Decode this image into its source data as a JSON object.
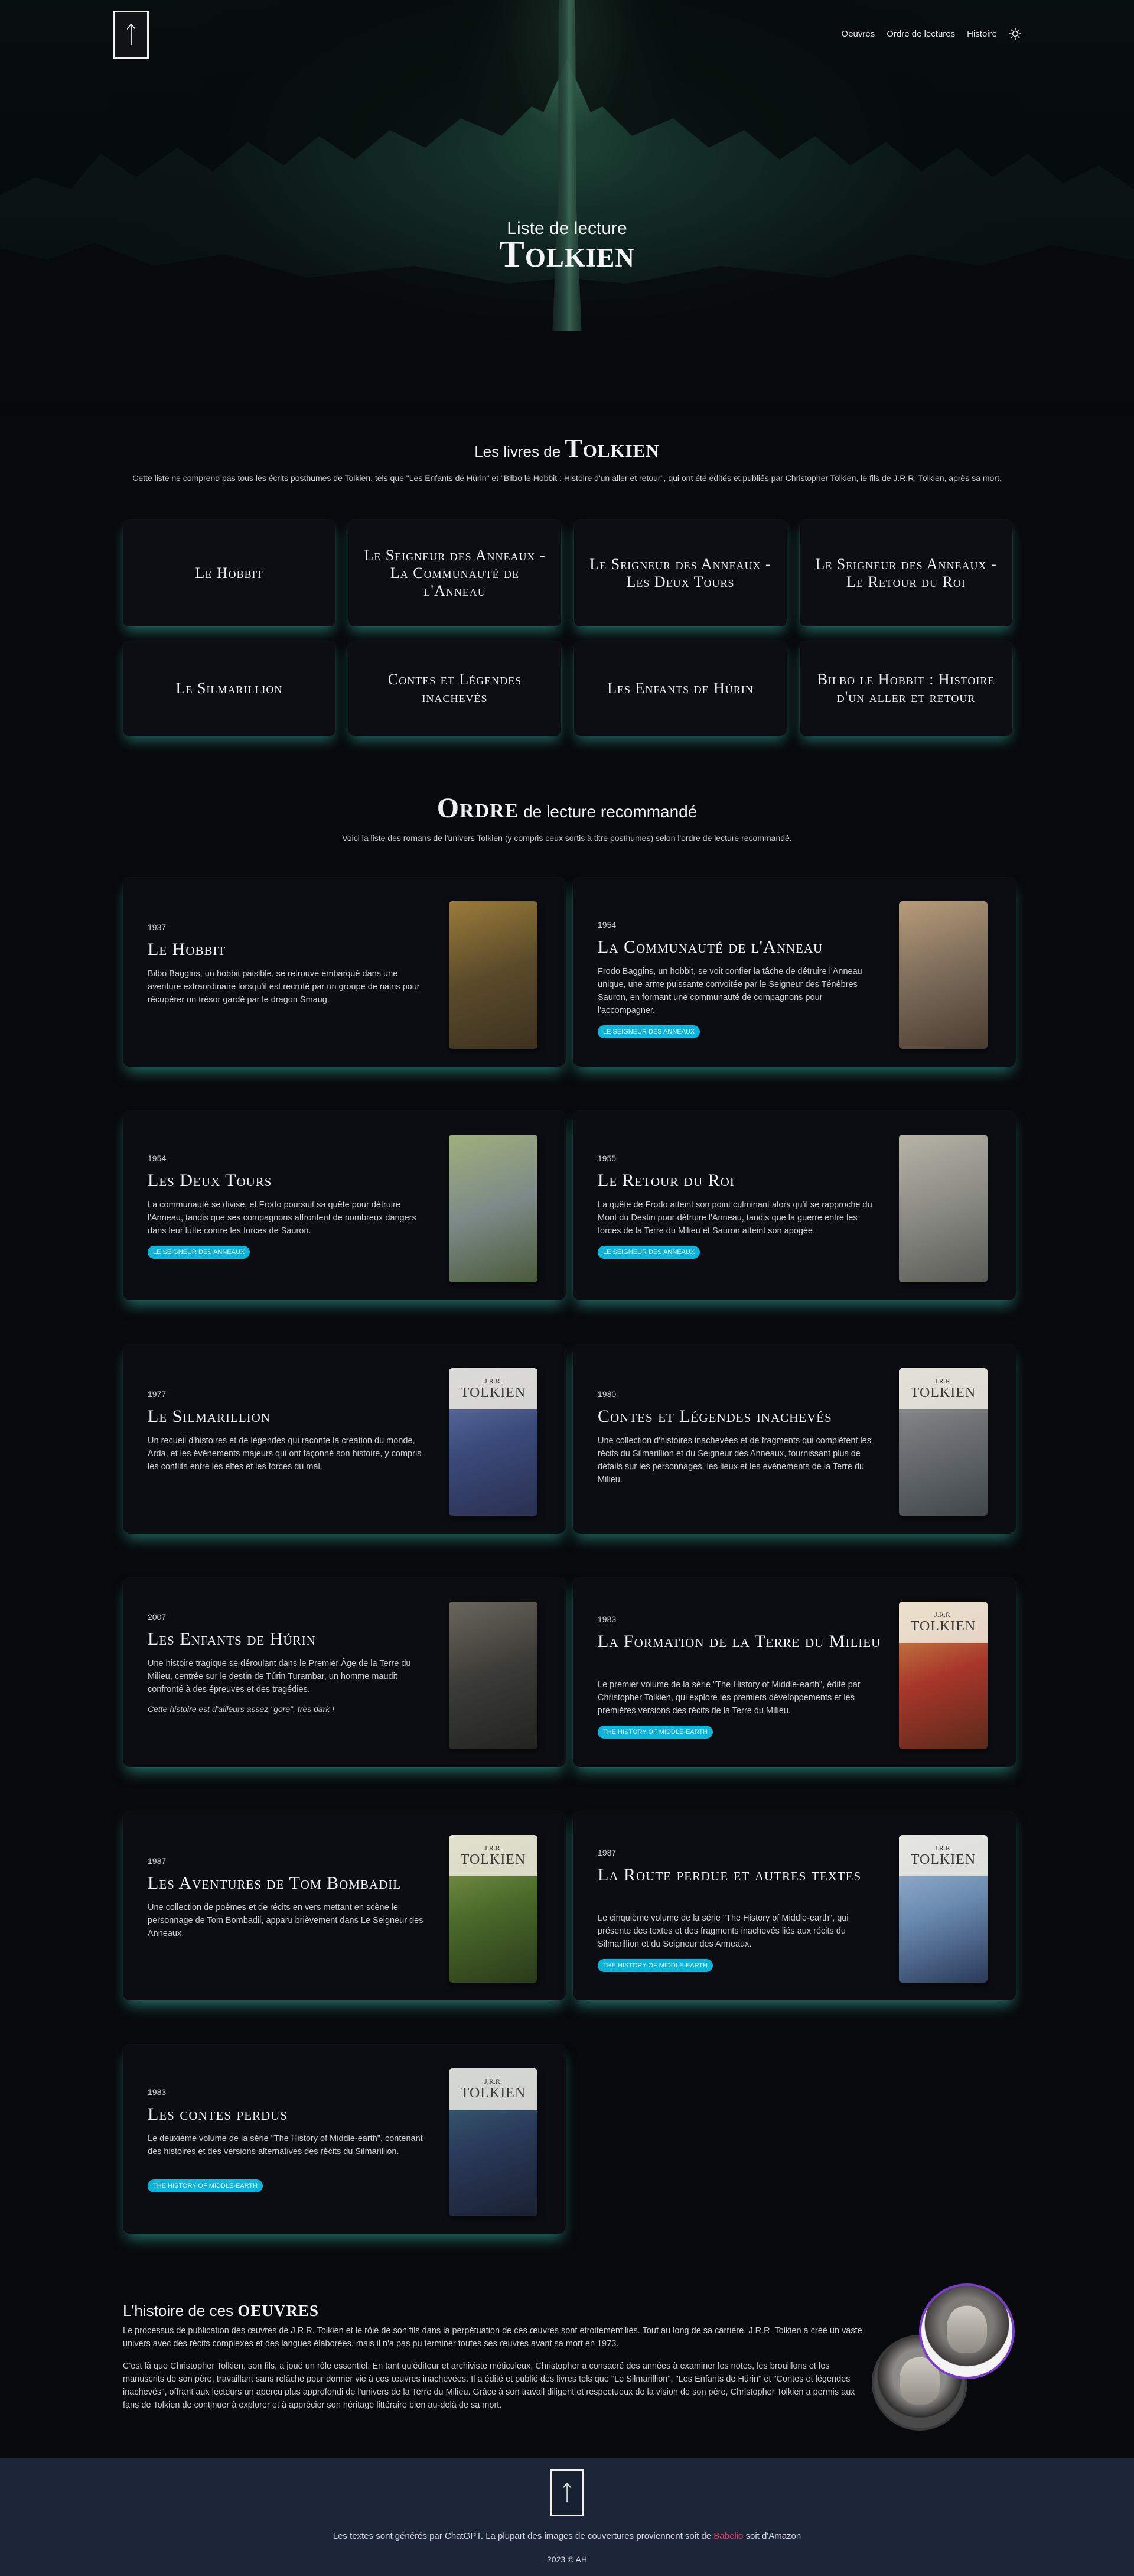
{
  "nav": {
    "items": [
      "Oeuvres",
      "Ordre de lectures",
      "Histoire"
    ],
    "theme_icon": "sun-icon"
  },
  "hero": {
    "subtitle": "Liste de lecture",
    "title": "Tolkien",
    "logo_icon": "tolkien-monogram-icon"
  },
  "books": {
    "title_prefix": "Les livres de",
    "title_big": "Tolkien",
    "description": "Cette liste ne comprend pas tous les écrits posthumes de Tolkien, tels que \"Les Enfants de Húrin\" et \"Bilbo le Hobbit : Histoire d'un aller et retour\", qui ont été édités et publiés par Christopher Tolkien, le fils de J.R.R. Tolkien, après sa mort.",
    "items": [
      "Le Hobbit",
      "Le Seigneur des Anneaux - La Communauté de l'Anneau",
      "Le Seigneur des Anneaux - Les Deux Tours",
      "Le Seigneur des Anneaux - Le Retour du Roi",
      "Le Silmarillion",
      "Contes et Légendes inachevés",
      "Les Enfants de Húrin",
      "Bilbo le Hobbit : Histoire d'un aller et retour"
    ]
  },
  "order": {
    "title_big": "Ordre",
    "title_rest": "de lecture recommandé",
    "description": "Voici la liste des romans de l'univers Tolkien (y compris ceux sortis à titre posthumes) selon l'ordre de lecture recommandé.",
    "cards": [
      {
        "year": "1937",
        "title": "Le Hobbit",
        "desc": "Bilbo Baggins, un hobbit paisible, se retrouve embarqué dans une aventure extraordinaire lorsqu'il est recruté par un groupe de nains pour récupérer un trésor gardé par le dragon Smaug.",
        "badge": "",
        "note": "",
        "cover_top": "",
        "cover_name": "",
        "cover_colors": [
          "#5a4a2a",
          "#9a7b3a",
          "#3d3220"
        ]
      },
      {
        "year": "1954",
        "title": "La Communauté de l'Anneau",
        "desc": "Frodo Baggins, un hobbit, se voit confier la tâche de détruire l'Anneau unique, une arme puissante convoitée par le Seigneur des Ténèbres Sauron, en formant une communauté de compagnons pour l'accompagner.",
        "badge": "Le Seigneur des Anneaux",
        "note": "",
        "cover_top": "",
        "cover_name": "",
        "cover_colors": [
          "#7a6a58",
          "#b89c7a",
          "#4a3c30"
        ]
      },
      {
        "year": "1954",
        "title": "Les Deux Tours",
        "desc": "La communauté se divise, et Frodo poursuit sa quête pour détruire l'Anneau, tandis que ses compagnons affrontent de nombreux dangers dans leur lutte contre les forces de Sauron.",
        "badge": "Le Seigneur des Anneaux",
        "note": "",
        "cover_top": "",
        "cover_name": "",
        "cover_colors": [
          "#7d8a88",
          "#9fb07c",
          "#4a5a3a"
        ]
      },
      {
        "year": "1955",
        "title": "Le Retour du Roi",
        "desc": "La quête de Frodo atteint son point culminant alors qu'il se rapproche du Mont du Destin pour détruire l'Anneau, tandis que la guerre entre les forces de la Terre du Milieu et Sauron atteint son apogée.",
        "badge": "Le Seigneur des Anneaux",
        "note": "",
        "cover_top": "",
        "cover_name": "",
        "cover_colors": [
          "#8a8a84",
          "#b7b3a6",
          "#5a5a56"
        ]
      },
      {
        "year": "1977",
        "title": "Le Silmarillion",
        "desc": "Un recueil d'histoires et de légendes qui raconte la création du monde, Arda, et les événements majeurs qui ont façonné son histoire, y compris les conflits entre les elfes et les forces du mal.",
        "badge": "",
        "note": "",
        "cover_top": "J.R.R.",
        "cover_name": "TOLKIEN",
        "cover_colors": [
          "#3a4a7a",
          "#6a7ab0",
          "#2a3050"
        ]
      },
      {
        "year": "1980",
        "title": "Contes et Légendes inachevés",
        "desc": "Une collection d'histoires inachevées et de fragments qui complètent les récits du Silmarillion et du Seigneur des Anneaux, fournissant plus de détails sur les personnages, les lieux et les événements de la Terre du Milieu.",
        "badge": "",
        "note": "",
        "cover_top": "J.R.R.",
        "cover_name": "TOLKIEN",
        "cover_colors": [
          "#6a6e72",
          "#9a9c98",
          "#40464a"
        ]
      },
      {
        "year": "2007",
        "title": "Les Enfants de Húrin",
        "desc": "Une histoire tragique se déroulant dans le Premier Âge de la Terre du Milieu, centrée sur le destin de Túrin Turambar, un homme maudit confronté à des épreuves et des tragédies.",
        "badge": "",
        "note": "Cette histoire est d'ailleurs assez \"gore\", très dark !",
        "cover_top": "",
        "cover_name": "",
        "cover_colors": [
          "#3a3a36",
          "#6a665c",
          "#22221f"
        ]
      },
      {
        "year": "1983",
        "title": "La Formation de la Terre du Milieu",
        "desc": "Le premier volume de la série \"The History of Middle-earth\", édité par Christopher Tolkien, qui explore les premiers développements et les premières versions des récits de la Terre du Milieu.",
        "badge": "The History of Middle-earth",
        "note": "",
        "cover_top": "J.R.R.",
        "cover_name": "TOLKIEN",
        "cover_colors": [
          "#a8362a",
          "#d0a050",
          "#5a2a1a"
        ]
      },
      {
        "year": "1987",
        "title": "Les Aventures de Tom Bombadil",
        "desc": "Une collection de poèmes et de récits en vers mettant en scène le personnage de Tom Bombadil, apparu brièvement dans Le Seigneur des Anneaux.",
        "badge": "",
        "note": "",
        "cover_top": "J.R.R.",
        "cover_name": "TOLKIEN",
        "cover_colors": [
          "#4a6a2a",
          "#8aa050",
          "#2a3a1a"
        ]
      },
      {
        "year": "1987",
        "title": "La Route perdue et autres textes",
        "desc": "Le cinquième volume de la série \"The History of Middle-earth\", qui présente des textes et des fragments inachevés liés aux récits du Silmarillion et du Seigneur des Anneaux.",
        "badge": "The History of Middle-earth",
        "note": "",
        "cover_top": "J.R.R.",
        "cover_name": "TOLKIEN",
        "cover_colors": [
          "#6a8ab0",
          "#a8c0d8",
          "#2a3a5a"
        ]
      },
      {
        "year": "1983",
        "title": "Les contes perdus",
        "desc": "Le deuxième volume de la série \"The History of Middle-earth\", contenant des histoires et des versions alternatives des récits du Silmarillion.",
        "badge": "The History of Middle-earth",
        "note": "",
        "cover_top": "J.R.R.",
        "cover_name": "TOLKIEN",
        "cover_colors": [
          "#2a3a5a",
          "#3a6a7a",
          "#1a2030"
        ]
      }
    ]
  },
  "history": {
    "title_prefix": "L'histoire de ces",
    "title_big": "oeuvres",
    "p1": "Le processus de publication des œuvres de J.R.R. Tolkien et le rôle de son fils dans la perpétuation de ces œuvres sont étroitement liés. Tout au long de sa carrière, J.R.R. Tolkien a créé un vaste univers avec des récits complexes et des langues élaborées, mais il n'a pas pu terminer toutes ses œuvres avant sa mort en 1973.",
    "p2": "C'est là que Christopher Tolkien, son fils, a joué un rôle essentiel. En tant qu'éditeur et archiviste méticuleux, Christopher a consacré des années à examiner les notes, les brouillons et les manuscrits de son père, travaillant sans relâche pour donner vie à ces œuvres inachevées. Il a édité et publié des livres tels que \"Le Silmarillion\", \"Les Enfants de Húrin\" et \"Contes et légendes inachevés\", offrant aux lecteurs un aperçu plus approfondi de l'univers de la Terre du Milieu. Grâce à son travail diligent et respectueux de la vision de son père, Christopher Tolkien a permis aux fans de Tolkien de continuer à explorer et à apprécier son héritage littéraire bien au-delà de sa mort."
  },
  "footer": {
    "text_before": "Les textes sont générés par ChatGPT. La plupart des images de couvertures proviennent soit de",
    "link": "Babelio",
    "text_after": "soit d'Amazon",
    "copyright": "2023 © AH"
  },
  "colors": {
    "accent_glow": "#3cd2be",
    "badge": "#0bb4d8",
    "link": "#e0416a",
    "footer_bg": "#1d2638",
    "avatar_ring": "#7a3cc9"
  }
}
